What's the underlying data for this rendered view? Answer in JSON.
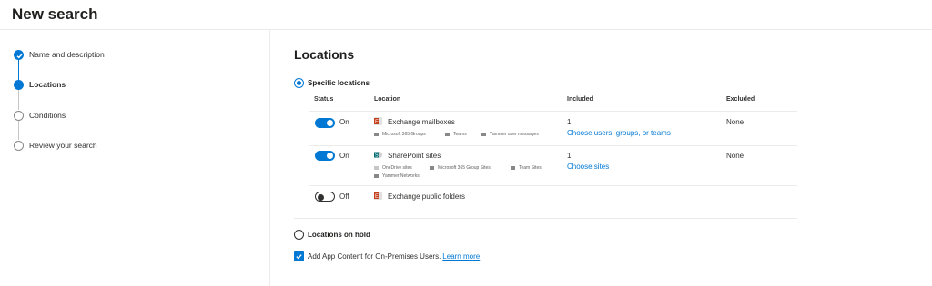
{
  "page_title": "New search",
  "wizard_steps": [
    {
      "label": "Name and description",
      "state": "done"
    },
    {
      "label": "Locations",
      "state": "current"
    },
    {
      "label": "Conditions",
      "state": "pending"
    },
    {
      "label": "Review your search",
      "state": "pending"
    }
  ],
  "section_title": "Locations",
  "specific_locations_label": "Specific locations",
  "columns": {
    "status": "Status",
    "location": "Location",
    "included": "Included",
    "excluded": "Excluded"
  },
  "rows": [
    {
      "toggle": "On",
      "name": "Exchange mailboxes",
      "icon": "exchange-icon",
      "sub_items": [
        "Microsoft 365 Groups",
        "Teams",
        "Yammer user messages"
      ],
      "included_count": "1",
      "included_link": "Choose users, groups, or teams",
      "excluded": "None"
    },
    {
      "toggle": "On",
      "name": "SharePoint sites",
      "icon": "sharepoint-icon",
      "sub_items": [
        "OneDrive sites",
        "Microsoft 365 Group Sites",
        "Team Sites",
        "Yammer Networks"
      ],
      "included_count": "1",
      "included_link": "Choose sites",
      "excluded": "None"
    },
    {
      "toggle": "Off",
      "name": "Exchange public folders",
      "icon": "exchange-icon"
    }
  ],
  "locations_on_hold_label": "Locations on hold",
  "app_content_label": "Add App Content for On-Premises Users.",
  "learn_more": "Learn more",
  "colors": {
    "accent": "#0078d4",
    "text": "#323130",
    "divider": "#edebe9"
  }
}
